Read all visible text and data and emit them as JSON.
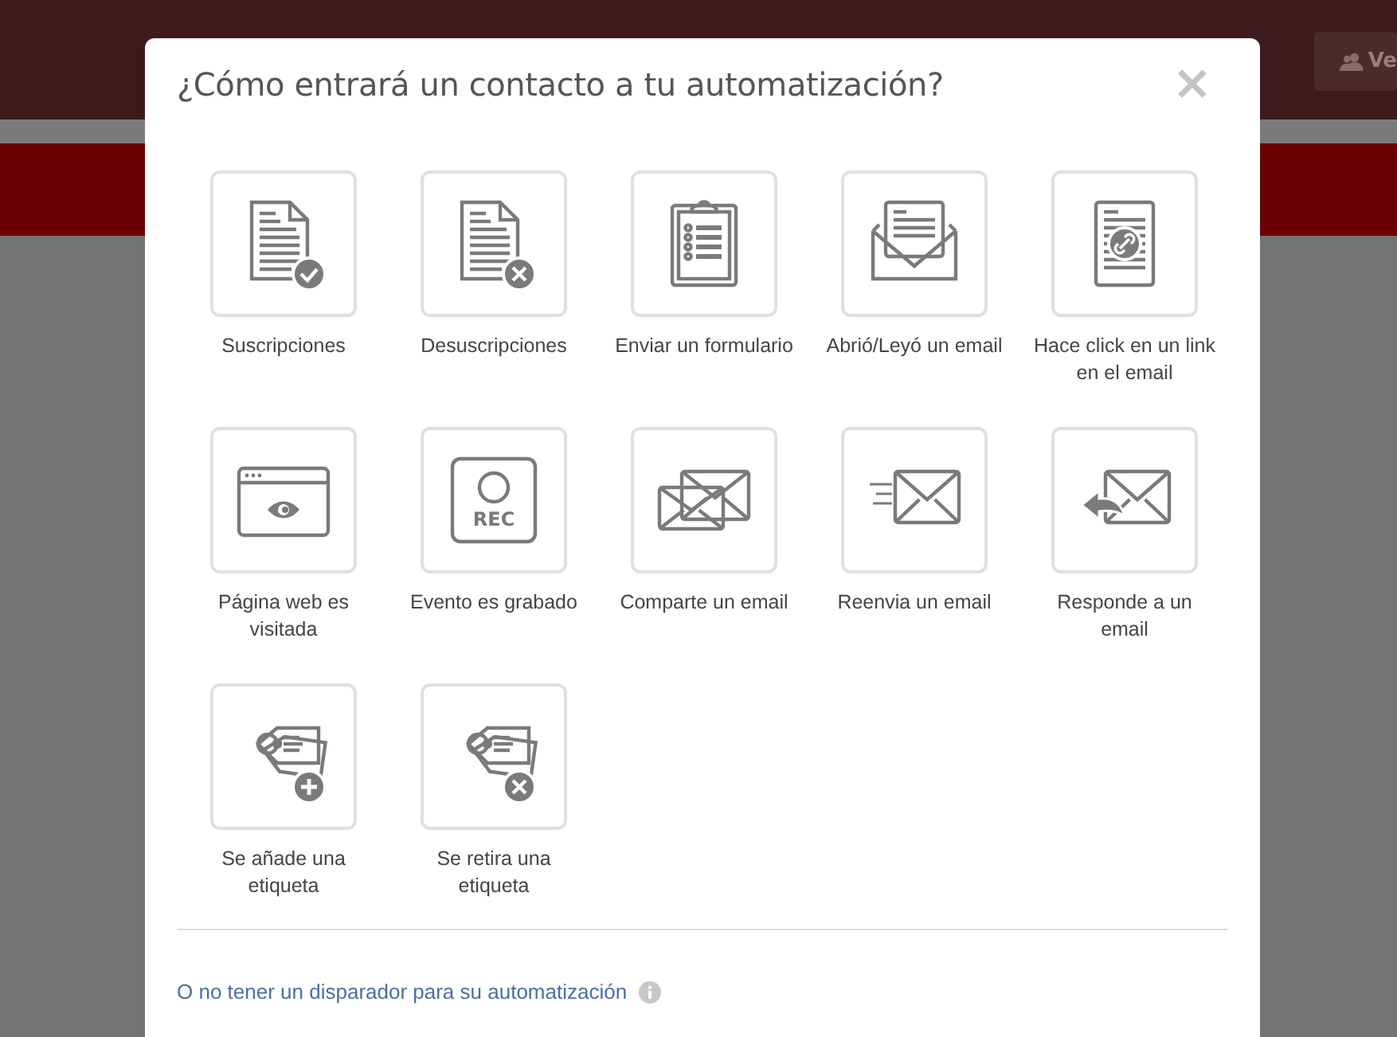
{
  "header": {
    "button": "Ve"
  },
  "modal": {
    "title": "¿Cómo entrará un contacto a tu automatización?",
    "close": "×",
    "triggers": [
      {
        "label": "Suscripciones",
        "kind": "doc-check"
      },
      {
        "label": "Desuscripciones",
        "kind": "doc-x"
      },
      {
        "label": "Enviar un formulario",
        "kind": "clipboard"
      },
      {
        "label": "Abrió/Leyó un email",
        "kind": "open-envelope"
      },
      {
        "label": "Hace click en un link en el email",
        "kind": "doc-link"
      },
      {
        "label": "Página web es visitada",
        "kind": "browser-eye"
      },
      {
        "label": "Evento es grabado",
        "kind": "rec",
        "icon_text": "REC"
      },
      {
        "label": "Comparte un email",
        "kind": "envelopes"
      },
      {
        "label": "Reenvia un email",
        "kind": "envelope-fast"
      },
      {
        "label": "Responde a un email",
        "kind": "envelope-reply"
      },
      {
        "label": "Se añade una etiqueta",
        "kind": "tag-plus"
      },
      {
        "label": "Se retira una etiqueta",
        "kind": "tag-x"
      }
    ],
    "footer_link": "O no tener un disparador para su automatización"
  }
}
